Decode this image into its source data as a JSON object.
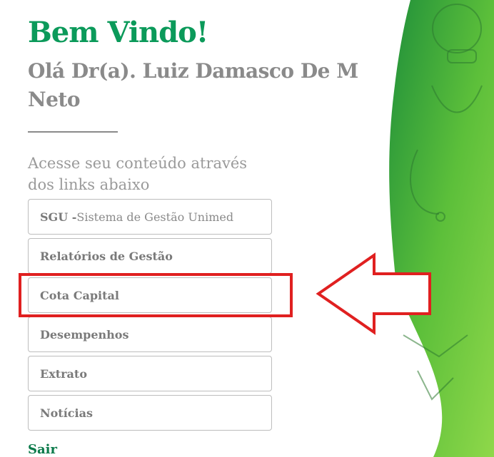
{
  "header": {
    "welcome": "Bem Vindo!",
    "greeting": "Olá Dr(a). Luiz Damasco De M Neto"
  },
  "intro_text": "Acesse seu conteúdo através dos links abaixo",
  "links": [
    {
      "bold": "SGU - ",
      "light": "Sistema de Gestão Unimed"
    },
    {
      "bold": "Relatórios de Gestão",
      "light": ""
    },
    {
      "bold": "Cota Capital",
      "light": ""
    },
    {
      "bold": "Desempenhos",
      "light": ""
    },
    {
      "bold": "Extrato",
      "light": ""
    },
    {
      "bold": "Notícias",
      "light": ""
    }
  ],
  "logout_label": "Sair",
  "colors": {
    "brand_green": "#0b9a5a",
    "annotation_red": "#e02020"
  },
  "decorations": {
    "background_image": "doctor-photo-green-overlay",
    "annotation": "red-highlight-box-and-arrow-pointing-left"
  }
}
